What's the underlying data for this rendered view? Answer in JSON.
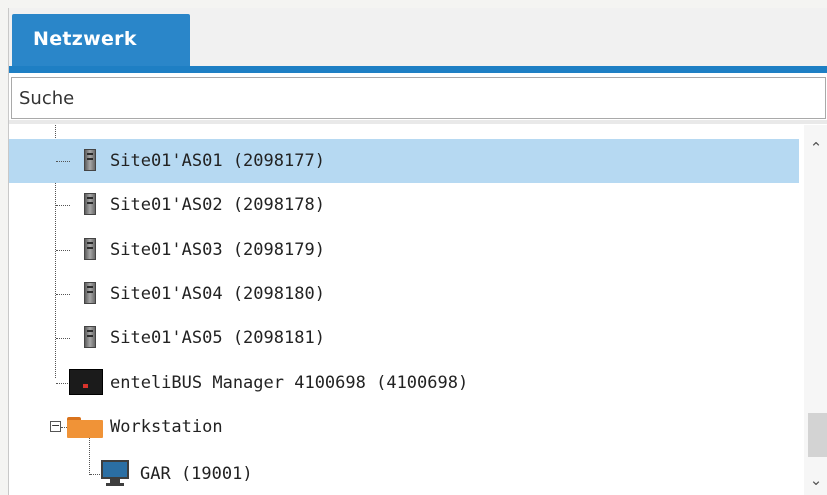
{
  "tabs": [
    {
      "label": "Netzwerk",
      "active": true
    }
  ],
  "search": {
    "placeholder": "Suche",
    "value": ""
  },
  "tree": {
    "rows": [
      {
        "label": "Site01'AS01 (2098177)",
        "icon": "server-icon",
        "selected": true
      },
      {
        "label": "Site01'AS02 (2098178)",
        "icon": "server-icon",
        "selected": false
      },
      {
        "label": "Site01'AS03 (2098179)",
        "icon": "server-icon",
        "selected": false
      },
      {
        "label": "Site01'AS04 (2098180)",
        "icon": "server-icon",
        "selected": false
      },
      {
        "label": "Site01'AS05 (2098181)",
        "icon": "server-icon",
        "selected": false
      },
      {
        "label": "enteliBUS Manager 4100698 (4100698)",
        "icon": "controller-device-icon",
        "selected": false
      },
      {
        "label": "Workstation",
        "icon": "folder-icon",
        "expanded": true,
        "selected": false
      },
      {
        "label": "GAR (19001)",
        "icon": "workstation-monitor-icon",
        "selected": false
      }
    ]
  },
  "colors": {
    "accent": "#2a86c9",
    "selection": "#b6d9f2",
    "folder": "#f09337"
  }
}
